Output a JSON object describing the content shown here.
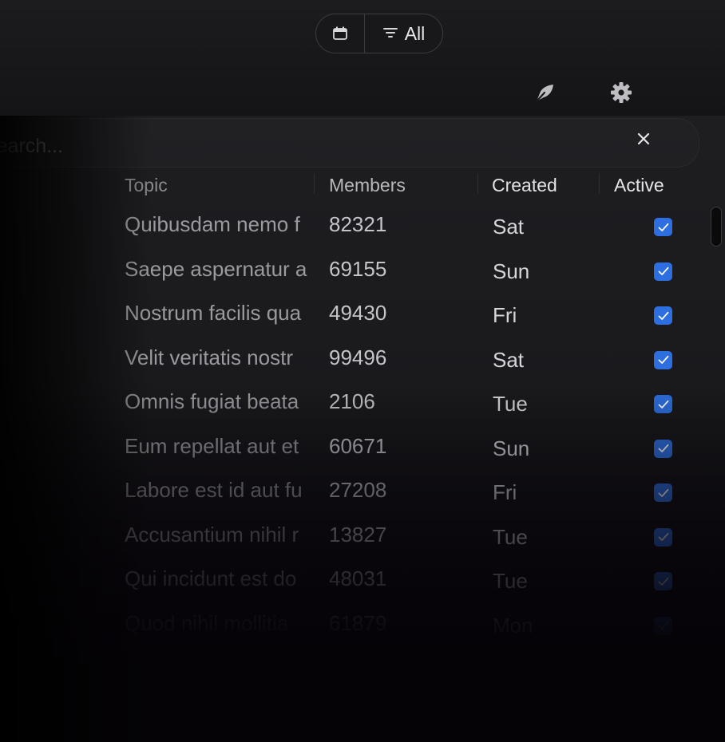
{
  "toolbar": {
    "calendar_icon": "calendar-icon",
    "filter_icon": "filter-icon",
    "filter_label": "All",
    "compose_icon": "compose-icon",
    "settings_icon": "gear-icon"
  },
  "search": {
    "placeholder": "Search...",
    "close_icon": "close-icon"
  },
  "table": {
    "columns": {
      "topic": "Topic",
      "members": "Members",
      "created": "Created",
      "active": "Active"
    },
    "rows": [
      {
        "topic": "Quibusdam nemo f",
        "members": "82321",
        "created": "Sat",
        "active": true
      },
      {
        "topic": "Saepe aspernatur a",
        "members": "69155",
        "created": "Sun",
        "active": true
      },
      {
        "topic": "Nostrum facilis qua",
        "members": "49430",
        "created": "Fri",
        "active": true
      },
      {
        "topic": "Velit veritatis nostr",
        "members": "99496",
        "created": "Sat",
        "active": true
      },
      {
        "topic": "Omnis fugiat beata",
        "members": "2106",
        "created": "Tue",
        "active": true
      },
      {
        "topic": "Eum repellat aut et",
        "members": "60671",
        "created": "Sun",
        "active": true
      },
      {
        "topic": "Labore est id aut fu",
        "members": "27208",
        "created": "Fri",
        "active": true
      },
      {
        "topic": "Accusantium nihil r",
        "members": "13827",
        "created": "Tue",
        "active": true
      },
      {
        "topic": "Qui incidunt est do",
        "members": "48031",
        "created": "Tue",
        "active": true
      },
      {
        "topic": "Quod nihil mollitia",
        "members": "61879",
        "created": "Mon",
        "active": true
      }
    ]
  },
  "colors": {
    "checkbox": "#2d6fe0",
    "background": "#1c1c1e"
  }
}
